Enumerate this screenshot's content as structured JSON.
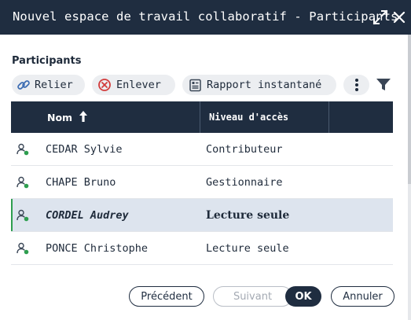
{
  "window": {
    "title": "Nouvel espace de travail collaboratif - Participants",
    "expand_icon": "expand-arrows-icon",
    "close_icon": "close-icon"
  },
  "section": {
    "label": "Participants"
  },
  "toolbar": {
    "relier_label": "Relier",
    "relier_icon": "link-icon",
    "enlever_label": "Enlever",
    "enlever_icon": "remove-circle-icon",
    "rapport_label": "Rapport instantané",
    "rapport_icon": "report-icon",
    "more_icon": "more-vertical-icon",
    "filter_icon": "filter-icon"
  },
  "table": {
    "columns": [
      {
        "label": "Nom",
        "sort": "ascending"
      },
      {
        "label": "Niveau d'accès"
      }
    ],
    "rows": [
      {
        "name": "CEDAR Sylvie",
        "access": "Contributeur",
        "selected": false
      },
      {
        "name": "CHAPE Bruno",
        "access": "Gestionnaire",
        "selected": false
      },
      {
        "name": "CORDEL Audrey",
        "access": "Lecture seule",
        "selected": true
      },
      {
        "name": "PONCE Christophe",
        "access": "Lecture seule",
        "selected": false
      }
    ]
  },
  "footer": {
    "prev_label": "Précédent",
    "next_label": "Suivant",
    "ok_label": "OK",
    "cancel_label": "Annuler"
  },
  "colors": {
    "header_bg": "#1f2d40",
    "selected_row_bg": "#dde4ee",
    "status_online": "#2e9e4f",
    "pill_bg": "#eceef1",
    "remove_red": "#d23c3c"
  }
}
